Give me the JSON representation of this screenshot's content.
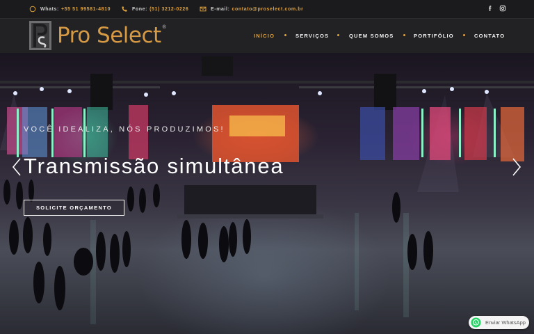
{
  "topbar": {
    "whats": {
      "label": "Whats:",
      "value": "+55 51 99581-4810",
      "icon": "whatsapp-icon"
    },
    "phone": {
      "label": "Fone:",
      "value": "(51) 3212-0226",
      "icon": "phone-icon"
    },
    "email": {
      "label": "E-mail:",
      "value": "contato@proselect.com.br",
      "icon": "envelope-icon"
    },
    "social": [
      "facebook-icon",
      "instagram-icon"
    ]
  },
  "brand": {
    "name": "Pro Select",
    "mark": "®"
  },
  "nav": {
    "items": [
      "INÍCIO",
      "SERVIÇOS",
      "QUEM SOMOS",
      "PORTIFÓLIO",
      "CONTATO"
    ],
    "active_index": 0
  },
  "hero": {
    "tagline": "VOCÊ IDEALIZA, NÓS PRODUZIMOS!",
    "headline": "Transmissão simultânea",
    "cta": "SOLICITE ORÇAMENTO"
  },
  "whatsapp_button": {
    "label": "Enviar WhatsApp"
  },
  "colors": {
    "accent": "#e0a23c",
    "topbar_bg": "#1b1b1d",
    "navbar_bg": "#222224",
    "whatsapp_green": "#25d366"
  }
}
